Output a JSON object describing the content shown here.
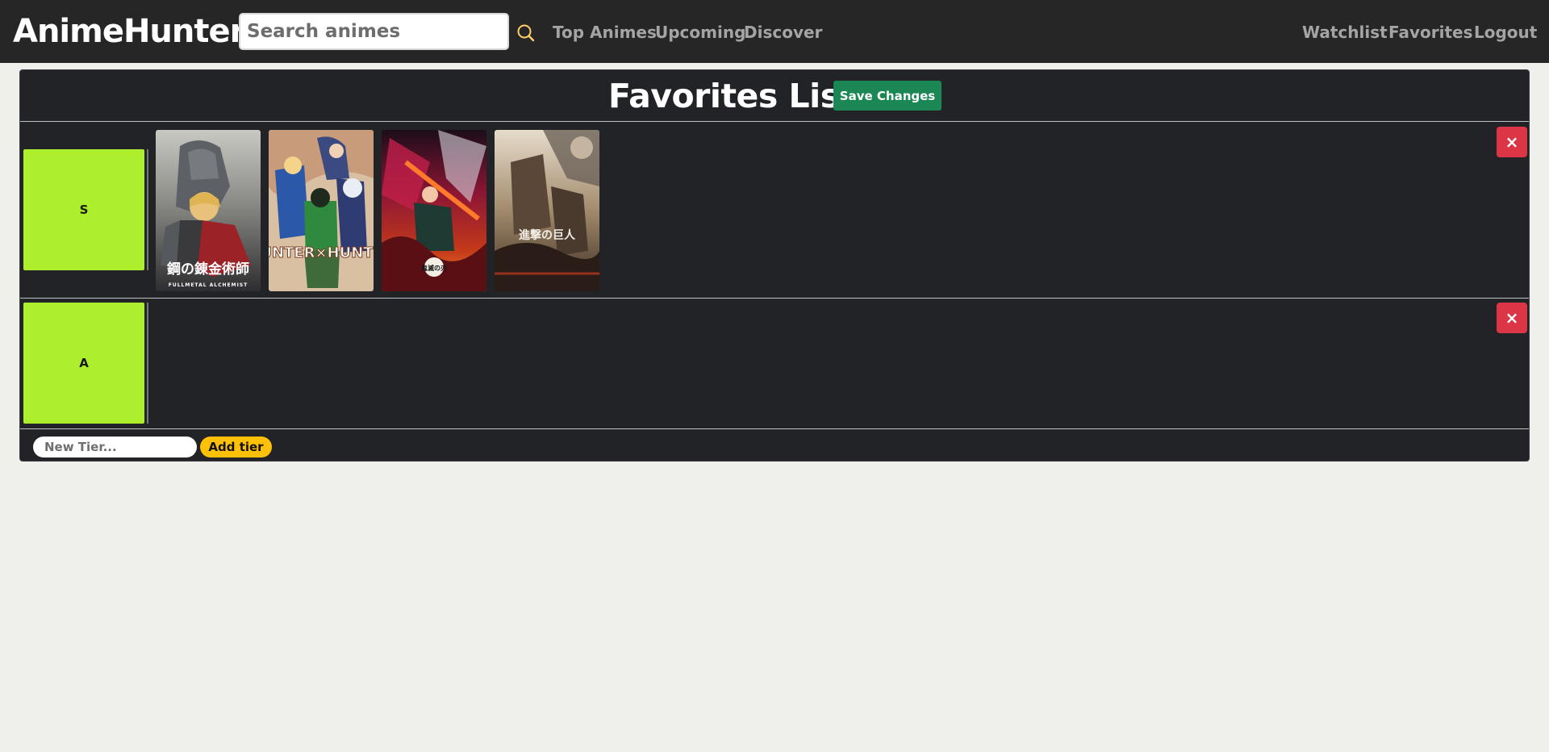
{
  "nav": {
    "brand": "AnimeHunter",
    "search_placeholder": "Search animes",
    "search_icon": "search-icon",
    "links_left": [
      "Top Animes",
      "Upcoming",
      "Discover"
    ],
    "links_right": [
      "Watchlist",
      "Favorites",
      "Logout"
    ]
  },
  "colors": {
    "navbar_bg": "#262626",
    "panel_bg": "#212327",
    "tier_label_bg": "#adee2d",
    "save_button": "#1b8754",
    "delete_button": "#dc3545",
    "add_tier_button": "#ffc107"
  },
  "panel": {
    "title": "Favorites List",
    "save_label": "Save Changes"
  },
  "tiers": [
    {
      "label": "S",
      "delete_icon": "close-icon",
      "delete_label": "×",
      "posters": [
        {
          "name": "fullmetal-alchemist",
          "title_text": "鋼の錬金術師",
          "subtitle_text": "FULLMETAL ALCHEMIST"
        },
        {
          "name": "hunter-x-hunter",
          "title_text": "HUNTER×HUNTER"
        },
        {
          "name": "demon-slayer",
          "title_text": "鬼滅の刃"
        },
        {
          "name": "attack-on-titan",
          "title_text": "進撃の巨人"
        }
      ]
    },
    {
      "label": "A",
      "delete_icon": "close-icon",
      "delete_label": "×",
      "posters": []
    }
  ],
  "add_tier": {
    "placeholder": "New Tier...",
    "button_label": "Add tier"
  }
}
